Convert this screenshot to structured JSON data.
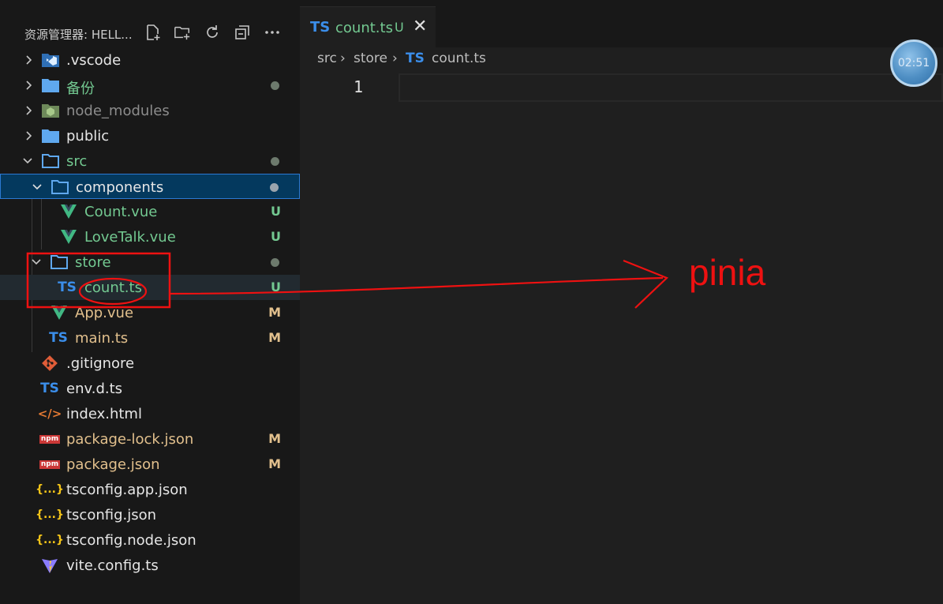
{
  "explorer": {
    "title": "资源管理器: HELL...",
    "actions": [
      "new-file-icon",
      "new-folder-icon",
      "refresh-icon",
      "collapse-all-icon",
      "more-icon"
    ],
    "items": [
      {
        "label": ".vscode",
        "icon": "vscode-folder-icon",
        "status": ""
      },
      {
        "label": "备份",
        "icon": "folder-icon",
        "status": "dot"
      },
      {
        "label": "node_modules",
        "icon": "node-folder-icon",
        "status": ""
      },
      {
        "label": "public",
        "icon": "folder-icon",
        "status": ""
      },
      {
        "label": "src",
        "icon": "folder-open-icon",
        "status": "dot"
      },
      {
        "label": "components",
        "icon": "folder-open-icon",
        "status": "dot"
      },
      {
        "label": "Count.vue",
        "icon": "vue-icon",
        "status": "U"
      },
      {
        "label": "LoveTalk.vue",
        "icon": "vue-icon",
        "status": "U"
      },
      {
        "label": "store",
        "icon": "folder-open-icon",
        "status": "dot"
      },
      {
        "label": "count.ts",
        "icon": "typescript-icon",
        "status": "U"
      },
      {
        "label": "App.vue",
        "icon": "vue-icon",
        "status": "M"
      },
      {
        "label": "main.ts",
        "icon": "typescript-icon",
        "status": "M"
      },
      {
        "label": ".gitignore",
        "icon": "git-icon",
        "status": ""
      },
      {
        "label": "env.d.ts",
        "icon": "typescript-icon",
        "status": ""
      },
      {
        "label": "index.html",
        "icon": "html-icon",
        "status": ""
      },
      {
        "label": "package-lock.json",
        "icon": "npm-icon",
        "status": "M"
      },
      {
        "label": "package.json",
        "icon": "npm-icon",
        "status": "M"
      },
      {
        "label": "tsconfig.app.json",
        "icon": "json-icon",
        "status": ""
      },
      {
        "label": "tsconfig.json",
        "icon": "json-icon",
        "status": ""
      },
      {
        "label": "tsconfig.node.json",
        "icon": "json-icon",
        "status": ""
      },
      {
        "label": "vite.config.ts",
        "icon": "vite-icon",
        "status": ""
      }
    ],
    "ts_badge": "TS",
    "json_badge": "{...}",
    "npm_badge": "npm",
    "html_badge": "</>"
  },
  "tab": {
    "lang": "TS",
    "name": "count.ts",
    "status": "U",
    "close": "✕"
  },
  "breadcrumb": {
    "part1": "src",
    "sep": "›",
    "part2": "store",
    "lang": "TS",
    "file": "count.ts"
  },
  "editor": {
    "line_number": "1"
  },
  "timer": {
    "time": "02:51"
  },
  "annotation": {
    "text": "pinia",
    "color": "#ee1111"
  },
  "colors": {
    "untracked": "#73c991",
    "modified": "#e2c08d",
    "selection": "#04395e",
    "ts": "#3b8eea"
  }
}
